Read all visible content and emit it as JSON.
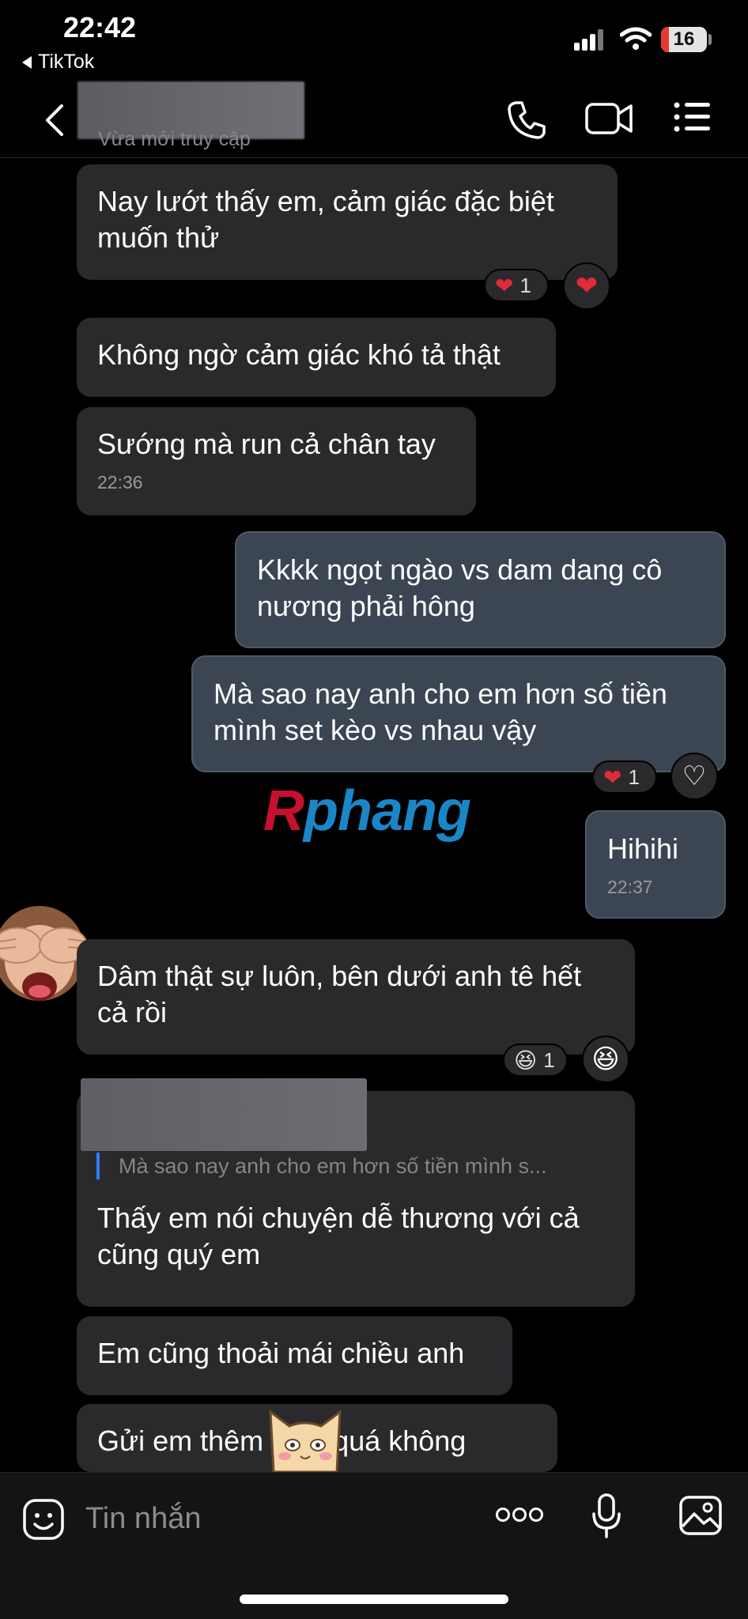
{
  "status_bar": {
    "time": "22:42",
    "back_app": "TikTok",
    "battery": "16"
  },
  "header": {
    "contact_name": ""
  },
  "cut_text": "Vừa mới truy cập",
  "messages": [
    {
      "text": "Nay lướt thấy em, cảm giác đặc biệt muốn thử",
      "reaction_count": "1"
    },
    {
      "text": "Không ngờ cảm giác khó tả thật"
    },
    {
      "text": "Sướng mà run cả chân tay",
      "time": "22:36"
    },
    {
      "text": "Kkkk ngọt ngào vs dam dang cô nương phải hông"
    },
    {
      "text": "Mà sao nay anh cho em hơn số tiền mình set kèo vs nhau vậy",
      "reaction_count": "1"
    },
    {
      "text": "Hihihi",
      "time": "22:37"
    },
    {
      "text": "Dâm thật sự luôn, bên dưới anh tê hết cả rồi",
      "reaction_count": "1"
    },
    {
      "text": "Thấy em nói chuyện dễ thương với cả cũng quý em",
      "quote": "Mà sao nay anh cho em hơn số tiền mình s..."
    },
    {
      "text": "Em cũng thoải mái chiều anh"
    },
    {
      "text": "Gửi em thêm có ít quá không"
    }
  ],
  "watermark": {
    "part1": "R",
    "part2": "phang"
  },
  "composer": {
    "placeholder": "Tin nhắn"
  },
  "colors": {
    "incoming_bubble": "#2a2a2d",
    "outgoing_bubble": "#3c4552",
    "quote_bar": "#2f7ef5"
  }
}
